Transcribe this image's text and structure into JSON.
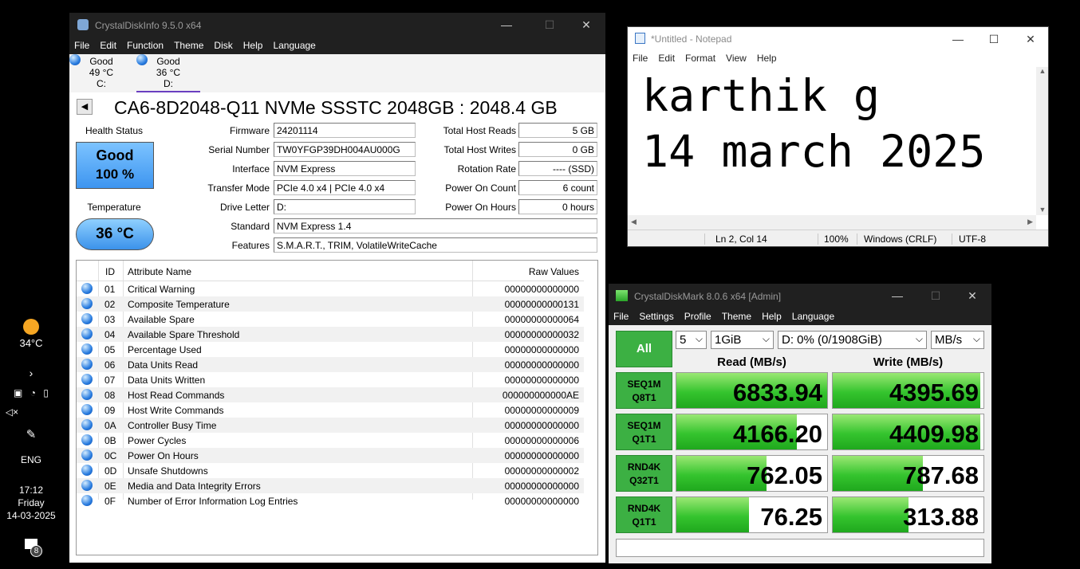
{
  "taskbar": {
    "weather_temp": "34°C",
    "language": "ENG",
    "time": "17:12",
    "day": "Friday",
    "date": "14-03-2025",
    "notification_count": "8"
  },
  "cdi": {
    "title": "CrystalDiskInfo 9.5.0 x64",
    "menu": [
      "File",
      "Edit",
      "Function",
      "Theme",
      "Disk",
      "Help",
      "Language"
    ],
    "drives": [
      {
        "status": "Good",
        "temp": "49 °C",
        "letter": "C:"
      },
      {
        "status": "Good",
        "temp": "36 °C",
        "letter": "D:"
      }
    ],
    "model": "CA6-8D2048-Q11 NVMe SSSTC 2048GB : 2048.4 GB",
    "health_label": "Health Status",
    "health_status": "Good",
    "health_percent": "100 %",
    "temp_label": "Temperature",
    "temp_value": "36 °C",
    "fields_left": [
      {
        "label": "Firmware",
        "value": "24201114"
      },
      {
        "label": "Serial Number",
        "value": "TW0YFGP39DH004AU000G"
      },
      {
        "label": "Interface",
        "value": "NVM Express"
      },
      {
        "label": "Transfer Mode",
        "value": "PCIe 4.0 x4 | PCIe 4.0 x4"
      },
      {
        "label": "Drive Letter",
        "value": "D:"
      }
    ],
    "fields_right": [
      {
        "label": "Total Host Reads",
        "value": "5 GB"
      },
      {
        "label": "Total Host Writes",
        "value": "0 GB"
      },
      {
        "label": "Rotation Rate",
        "value": "---- (SSD)"
      },
      {
        "label": "Power On Count",
        "value": "6 count"
      },
      {
        "label": "Power On Hours",
        "value": "0 hours"
      }
    ],
    "standard_label": "Standard",
    "standard_value": "NVM Express 1.4",
    "features_label": "Features",
    "features_value": "S.M.A.R.T., TRIM, VolatileWriteCache",
    "table_headers": {
      "id": "ID",
      "name": "Attribute Name",
      "raw": "Raw Values"
    },
    "attributes": [
      {
        "id": "01",
        "name": "Critical Warning",
        "raw": "00000000000000"
      },
      {
        "id": "02",
        "name": "Composite Temperature",
        "raw": "00000000000131"
      },
      {
        "id": "03",
        "name": "Available Spare",
        "raw": "00000000000064"
      },
      {
        "id": "04",
        "name": "Available Spare Threshold",
        "raw": "00000000000032"
      },
      {
        "id": "05",
        "name": "Percentage Used",
        "raw": "00000000000000"
      },
      {
        "id": "06",
        "name": "Data Units Read",
        "raw": "00000000000000"
      },
      {
        "id": "07",
        "name": "Data Units Written",
        "raw": "00000000000000"
      },
      {
        "id": "08",
        "name": "Host Read Commands",
        "raw": "000000000000AE"
      },
      {
        "id": "09",
        "name": "Host Write Commands",
        "raw": "00000000000009"
      },
      {
        "id": "0A",
        "name": "Controller Busy Time",
        "raw": "00000000000000"
      },
      {
        "id": "0B",
        "name": "Power Cycles",
        "raw": "00000000000006"
      },
      {
        "id": "0C",
        "name": "Power On Hours",
        "raw": "00000000000000"
      },
      {
        "id": "0D",
        "name": "Unsafe Shutdowns",
        "raw": "00000000000002"
      },
      {
        "id": "0E",
        "name": "Media and Data Integrity Errors",
        "raw": "00000000000000"
      },
      {
        "id": "0F",
        "name": "Number of Error Information Log Entries",
        "raw": "00000000000000"
      }
    ]
  },
  "notepad": {
    "title": "*Untitled - Notepad",
    "menu": [
      "File",
      "Edit",
      "Format",
      "View",
      "Help"
    ],
    "line1": "karthik g",
    "line2": "14 march 2025",
    "status": {
      "position": "Ln 2, Col 14",
      "zoom": "100%",
      "eol": "Windows (CRLF)",
      "encoding": "UTF-8"
    }
  },
  "cdm": {
    "title": "CrystalDiskMark 8.0.6 x64 [Admin]",
    "menu": [
      "File",
      "Settings",
      "Profile",
      "Theme",
      "Help",
      "Language"
    ],
    "all_label": "All",
    "count": "5",
    "size": "1GiB",
    "drive": "D: 0% (0/1908GiB)",
    "unit": "MB/s",
    "read_header": "Read (MB/s)",
    "write_header": "Write (MB/s)",
    "rows": [
      {
        "l1": "SEQ1M",
        "l2": "Q8T1",
        "read": "6833.94",
        "write": "4395.69",
        "read_fill": 1.0,
        "write_fill": 0.98
      },
      {
        "l1": "SEQ1M",
        "l2": "Q1T1",
        "read": "4166.20",
        "write": "4409.98",
        "read_fill": 0.8,
        "write_fill": 0.98
      },
      {
        "l1": "RND4K",
        "l2": "Q32T1",
        "read": "762.05",
        "write": "787.68",
        "read_fill": 0.6,
        "write_fill": 0.6
      },
      {
        "l1": "RND4K",
        "l2": "Q1T1",
        "read": "76.25",
        "write": "313.88",
        "read_fill": 0.48,
        "write_fill": 0.5
      }
    ]
  }
}
